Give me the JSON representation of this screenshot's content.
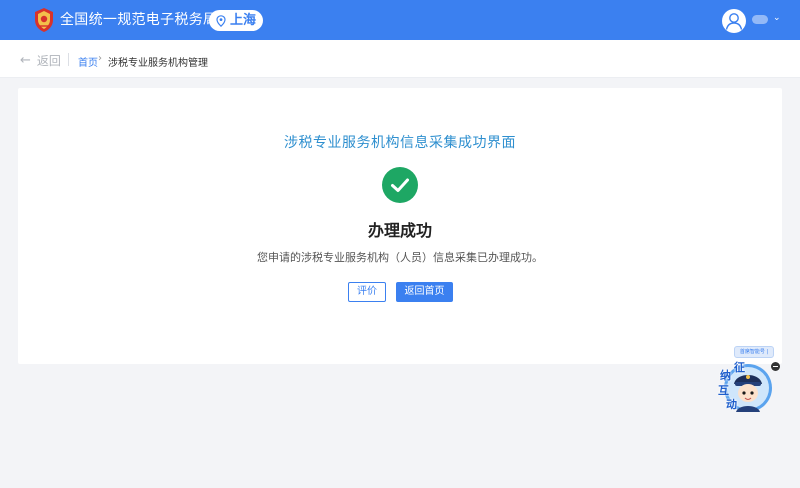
{
  "header": {
    "site_title": "全国统一规范电子税务局",
    "region": "上海",
    "icons": {
      "emblem": "tax-emblem-icon",
      "location": "location-pin-icon",
      "avatar": "user-avatar-icon",
      "chevron": "chevron-down-icon"
    },
    "colors": {
      "bar": "#3b80f0",
      "region_text": "#3b80f0"
    }
  },
  "breadcrumb": {
    "back_label": "返回",
    "home_label": "首页",
    "current_label": "涉税专业服务机构管理",
    "separator": "›"
  },
  "card": {
    "title": "涉税专业服务机构信息采集成功界面",
    "status_heading": "办理成功",
    "message": "您申请的涉税专业服务机构（人员）信息采集已办理成功。",
    "buttons": {
      "rate": "评价",
      "home": "返回首页"
    },
    "colors": {
      "title": "#2e8fcf",
      "success": "#1ea764",
      "primary": "#3b80f0"
    }
  },
  "assistant": {
    "tag_text": "首席智能号 |",
    "chars": [
      "征",
      "纳",
      "互",
      "动"
    ],
    "icons": {
      "close": "minus-close-icon",
      "mascot": "tax-officer-mascot-icon"
    }
  }
}
